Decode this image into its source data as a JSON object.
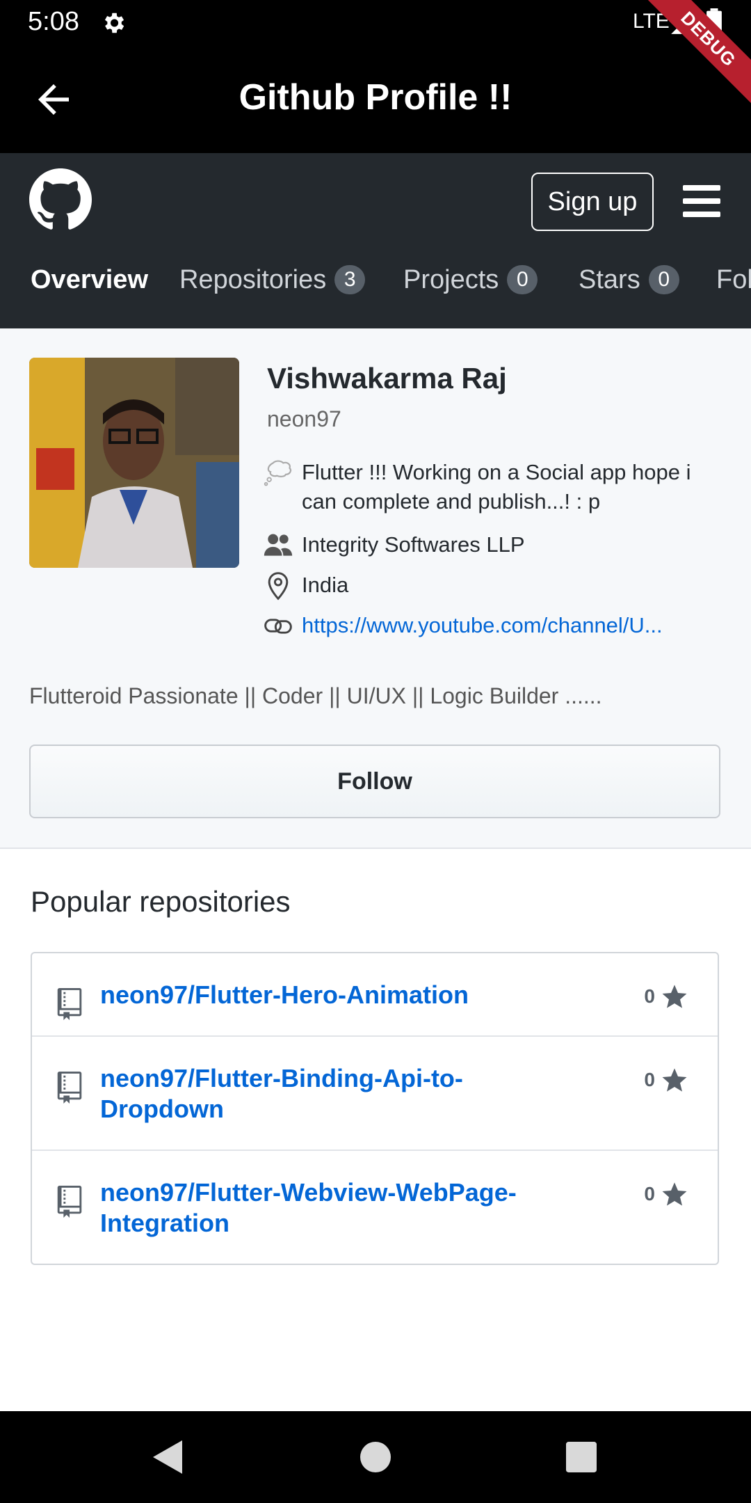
{
  "status_bar": {
    "time": "5:08",
    "network": "LTE"
  },
  "debug_banner": "DEBUG",
  "app_bar": {
    "title": "Github Profile !!"
  },
  "github_header": {
    "signup_label": "Sign up",
    "tabs": [
      {
        "label": "Overview",
        "count": null,
        "active": true
      },
      {
        "label": "Repositories",
        "count": "3"
      },
      {
        "label": "Projects",
        "count": "0"
      },
      {
        "label": "Stars",
        "count": "0"
      },
      {
        "label": "Fol",
        "count": null
      }
    ]
  },
  "profile": {
    "name": "Vishwakarma Raj",
    "username": "neon97",
    "bio": "Flutter !!! Working on a Social app hope i can complete and publish...! : p",
    "company": "Integrity Softwares LLP",
    "location": "India",
    "website": "https://www.youtube.com/channel/U...",
    "about": "Flutteroid Passionate || Coder || UI/UX || Logic Builder ......",
    "follow_label": "Follow"
  },
  "repositories": {
    "title": "Popular repositories",
    "items": [
      {
        "name": "neon97/Flutter-Hero-Animation",
        "stars": "0"
      },
      {
        "name": "neon97/Flutter-Binding-Api-to-Dropdown",
        "stars": "0"
      },
      {
        "name": "neon97/Flutter-Webview-WebPage-Integration",
        "stars": "0"
      }
    ]
  },
  "colors": {
    "github_header_bg": "#24292e",
    "link": "#0366d6",
    "debug_ribbon": "#b7202e"
  }
}
